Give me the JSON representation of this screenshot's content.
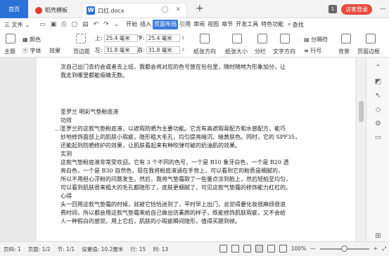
{
  "tabs": {
    "home": "首页",
    "template": "稻壳模板",
    "doc": "口红.docx",
    "badge": "1",
    "visitor": "访客登录"
  },
  "menu": {
    "file": "三 文件",
    "items": [
      "开始",
      "插入",
      "页面布局",
      "引用",
      "审阅",
      "视图",
      "章节",
      "开发工具",
      "特色功能"
    ],
    "active_index": 2,
    "search": "查找"
  },
  "ribbon": {
    "theme": "主题",
    "colors": "颜色",
    "fonts": "字体",
    "effects": "效果",
    "page_margin": "页边距",
    "top_label": "上:",
    "top_value": "25.4 毫米",
    "bottom_label": "下:",
    "bottom_value": "25.4 毫米",
    "left_label": "左:",
    "left_value": "31.8 毫米",
    "right_label": "右:",
    "right_value": "31.8 毫米",
    "orientation": "纸张方向",
    "size": "纸张大小",
    "columns": "分栏",
    "text_direction": "文字方向",
    "line_numbers": "行号",
    "breaks": "分隔符",
    "background": "背景",
    "page_border": "页面边框"
  },
  "document": {
    "p_top_1": "次自己出门去约会或者去上班，我都会将对应的色号放在包包里，随时随地为形象加分，让",
    "p_top_2": "我走到哪里都能吸睛无数。",
    "title": "圣罗兰 明彩气垫粉底液",
    "h_function": "功效",
    "p1_1": "圣罗兰的这款气垫粉底液，以遮瑕防晒为主要功能。它含有高遮瑕膏配方和水感配方，能巧",
    "p1_2": "妙地修饰面部上的肌肤小瑕疵，隐形粗大毛孔，均匀提亮暗沉、暗黄肤色。同时，它的 SPF35，",
    "p1_3": "还能起到防晒修护的效果，让肌肤看起来有种吹弹可破的奶油肌的效果。",
    "h_test": "实测",
    "p2_1": "这款气垫粉底液非常受欢迎。它有 3 个不同的色号，一个是 B10 象牙白色，一个是 B20 透",
    "p2_2": "亮白色，一个是 B30 自然色，现在我将粉底液涵在手背上，可以看到它的粉质是细腻的，",
    "p2_3": "所以不用担心浮粉的问题发生。然后，我将气垫霜取了一些量点涂到脸上，然后轻拍至均匀，",
    "p2_4": "可以看到肌肤很来粗大的毛孔都隐形了，皮肤更细腻了，可见这款气垫霜的修饰能力杠杠的。",
    "h_feeling": "心得",
    "p3_1": "头一回用这款气垫霜的时候，就被它恰恰迷到了，平时早上出门，总觉得要化妆很麻烦很浪",
    "p3_2": "费时间，所以都会用这款气垫霜来给自己做出仿素颜的样子，既能修饰肌肤瑕疵，又不会给",
    "p3_3": "人一种假白的感觉。用上它后，肌肤的小瑕疵瞬间隐形，值得买跟到帧。"
  },
  "status": {
    "page": "页码: 1",
    "pages": "页面: 1/2",
    "section": "节: 1/1",
    "position": "设置值: 10.2厘米",
    "row": "行: 15",
    "col": "列: 13",
    "zoom": "100%"
  }
}
